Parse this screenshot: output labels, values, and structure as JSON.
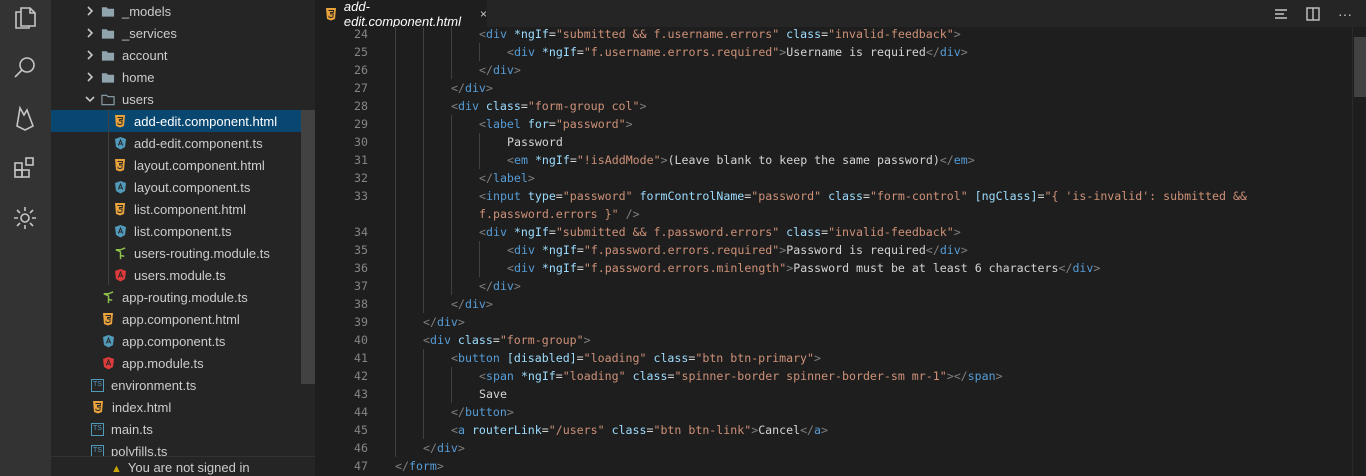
{
  "activity_bar": {
    "items": [
      {
        "icon": "files-icon"
      },
      {
        "icon": "search-icon"
      },
      {
        "icon": "firebase-icon"
      },
      {
        "icon": "extensions-icon"
      },
      {
        "icon": "gear-icon"
      }
    ]
  },
  "explorer": {
    "items": [
      {
        "label": "_models",
        "type": "folder",
        "depth": 1,
        "expanded": false
      },
      {
        "label": "_services",
        "type": "folder",
        "depth": 1,
        "expanded": false
      },
      {
        "label": "account",
        "type": "folder",
        "depth": 1,
        "expanded": false
      },
      {
        "label": "home",
        "type": "folder",
        "depth": 1,
        "expanded": false
      },
      {
        "label": "users",
        "type": "folder",
        "depth": 1,
        "expanded": true
      },
      {
        "label": "add-edit.component.html",
        "type": "html",
        "depth": 2,
        "selected": true
      },
      {
        "label": "add-edit.component.ts",
        "type": "angular-ts",
        "depth": 2
      },
      {
        "label": "layout.component.html",
        "type": "html",
        "depth": 2
      },
      {
        "label": "layout.component.ts",
        "type": "angular-ts",
        "depth": 2
      },
      {
        "label": "list.component.html",
        "type": "html",
        "depth": 2
      },
      {
        "label": "list.component.ts",
        "type": "angular-ts",
        "depth": 2
      },
      {
        "label": "users-routing.module.ts",
        "type": "routing",
        "depth": 2
      },
      {
        "label": "users.module.ts",
        "type": "angular-module",
        "depth": 2
      },
      {
        "label": "app-routing.module.ts",
        "type": "routing",
        "depth": 1
      },
      {
        "label": "app.component.html",
        "type": "html",
        "depth": 1
      },
      {
        "label": "app.component.ts",
        "type": "angular-ts",
        "depth": 1
      },
      {
        "label": "app.module.ts",
        "type": "angular-module",
        "depth": 1
      },
      {
        "label": "environment.ts",
        "type": "ts",
        "depth": 0
      },
      {
        "label": "index.html",
        "type": "html",
        "depth": 0
      },
      {
        "label": "main.ts",
        "type": "ts",
        "depth": 0
      },
      {
        "label": "polyfills.ts",
        "type": "ts",
        "depth": 0
      }
    ],
    "footer_text": "You are not signed in"
  },
  "tabs": [
    {
      "label": "add-edit.component.html",
      "close": "×",
      "active": true
    }
  ],
  "editor_actions": [
    {
      "icon": "open-changes-icon"
    },
    {
      "icon": "split-editor-icon"
    },
    {
      "icon": "more-actions-icon",
      "glyph": "···"
    }
  ],
  "code": {
    "lines": [
      {
        "n": "24",
        "indent": 3,
        "tokens": [
          [
            "p",
            "<"
          ],
          [
            "t",
            "div"
          ],
          [
            "x",
            " "
          ],
          [
            "a",
            "*ngIf"
          ],
          [
            "x",
            "="
          ],
          [
            "s",
            "\"submitted && f.username.errors\""
          ],
          [
            "x",
            " "
          ],
          [
            "a",
            "class"
          ],
          [
            "x",
            "="
          ],
          [
            "s",
            "\"invalid-feedback\""
          ],
          [
            "p",
            ">"
          ]
        ]
      },
      {
        "n": "25",
        "indent": 4,
        "tokens": [
          [
            "p",
            "<"
          ],
          [
            "t",
            "div"
          ],
          [
            "x",
            " "
          ],
          [
            "a",
            "*ngIf"
          ],
          [
            "x",
            "="
          ],
          [
            "s",
            "\"f.username.errors.required\""
          ],
          [
            "p",
            ">"
          ],
          [
            "x",
            "Username is required"
          ],
          [
            "p",
            "</"
          ],
          [
            "t",
            "div"
          ],
          [
            "p",
            ">"
          ]
        ]
      },
      {
        "n": "26",
        "indent": 3,
        "tokens": [
          [
            "p",
            "</"
          ],
          [
            "t",
            "div"
          ],
          [
            "p",
            ">"
          ]
        ]
      },
      {
        "n": "27",
        "indent": 2,
        "tokens": [
          [
            "p",
            "</"
          ],
          [
            "t",
            "div"
          ],
          [
            "p",
            ">"
          ]
        ]
      },
      {
        "n": "28",
        "indent": 2,
        "tokens": [
          [
            "p",
            "<"
          ],
          [
            "t",
            "div"
          ],
          [
            "x",
            " "
          ],
          [
            "a",
            "class"
          ],
          [
            "x",
            "="
          ],
          [
            "s",
            "\"form-group col\""
          ],
          [
            "p",
            ">"
          ]
        ]
      },
      {
        "n": "29",
        "indent": 3,
        "tokens": [
          [
            "p",
            "<"
          ],
          [
            "t",
            "label"
          ],
          [
            "x",
            " "
          ],
          [
            "a",
            "for"
          ],
          [
            "x",
            "="
          ],
          [
            "s",
            "\"password\""
          ],
          [
            "p",
            ">"
          ]
        ]
      },
      {
        "n": "30",
        "indent": 4,
        "tokens": [
          [
            "x",
            "Password"
          ]
        ]
      },
      {
        "n": "31",
        "indent": 4,
        "tokens": [
          [
            "p",
            "<"
          ],
          [
            "t",
            "em"
          ],
          [
            "x",
            " "
          ],
          [
            "a",
            "*ngIf"
          ],
          [
            "x",
            "="
          ],
          [
            "s",
            "\"!isAddMode\""
          ],
          [
            "p",
            ">"
          ],
          [
            "x",
            "(Leave blank to keep the same password)"
          ],
          [
            "p",
            "</"
          ],
          [
            "t",
            "em"
          ],
          [
            "p",
            ">"
          ]
        ]
      },
      {
        "n": "32",
        "indent": 3,
        "tokens": [
          [
            "p",
            "</"
          ],
          [
            "t",
            "label"
          ],
          [
            "p",
            ">"
          ]
        ]
      },
      {
        "n": "33",
        "indent": 3,
        "tokens": [
          [
            "p",
            "<"
          ],
          [
            "t",
            "input"
          ],
          [
            "x",
            " "
          ],
          [
            "a",
            "type"
          ],
          [
            "x",
            "="
          ],
          [
            "s",
            "\"password\""
          ],
          [
            "x",
            " "
          ],
          [
            "a",
            "formControlName"
          ],
          [
            "x",
            "="
          ],
          [
            "s",
            "\"password\""
          ],
          [
            "x",
            " "
          ],
          [
            "a",
            "class"
          ],
          [
            "x",
            "="
          ],
          [
            "s",
            "\"form-control\""
          ],
          [
            "x",
            " "
          ],
          [
            "a",
            "[ngClass]"
          ],
          [
            "x",
            "="
          ],
          [
            "s",
            "\"{ 'is-invalid': submitted &&"
          ]
        ]
      },
      {
        "n": "",
        "indent": 3,
        "tokens": [
          [
            "s",
            "f.password.errors }\""
          ],
          [
            "x",
            " "
          ],
          [
            "p",
            "/>"
          ]
        ]
      },
      {
        "n": "34",
        "indent": 3,
        "tokens": [
          [
            "p",
            "<"
          ],
          [
            "t",
            "div"
          ],
          [
            "x",
            " "
          ],
          [
            "a",
            "*ngIf"
          ],
          [
            "x",
            "="
          ],
          [
            "s",
            "\"submitted && f.password.errors\""
          ],
          [
            "x",
            " "
          ],
          [
            "a",
            "class"
          ],
          [
            "x",
            "="
          ],
          [
            "s",
            "\"invalid-feedback\""
          ],
          [
            "p",
            ">"
          ]
        ]
      },
      {
        "n": "35",
        "indent": 4,
        "tokens": [
          [
            "p",
            "<"
          ],
          [
            "t",
            "div"
          ],
          [
            "x",
            " "
          ],
          [
            "a",
            "*ngIf"
          ],
          [
            "x",
            "="
          ],
          [
            "s",
            "\"f.password.errors.required\""
          ],
          [
            "p",
            ">"
          ],
          [
            "x",
            "Password is required"
          ],
          [
            "p",
            "</"
          ],
          [
            "t",
            "div"
          ],
          [
            "p",
            ">"
          ]
        ]
      },
      {
        "n": "36",
        "indent": 4,
        "tokens": [
          [
            "p",
            "<"
          ],
          [
            "t",
            "div"
          ],
          [
            "x",
            " "
          ],
          [
            "a",
            "*ngIf"
          ],
          [
            "x",
            "="
          ],
          [
            "s",
            "\"f.password.errors.minlength\""
          ],
          [
            "p",
            ">"
          ],
          [
            "x",
            "Password must be at least 6 characters"
          ],
          [
            "p",
            "</"
          ],
          [
            "t",
            "div"
          ],
          [
            "p",
            ">"
          ]
        ]
      },
      {
        "n": "37",
        "indent": 3,
        "tokens": [
          [
            "p",
            "</"
          ],
          [
            "t",
            "div"
          ],
          [
            "p",
            ">"
          ]
        ]
      },
      {
        "n": "38",
        "indent": 2,
        "tokens": [
          [
            "p",
            "</"
          ],
          [
            "t",
            "div"
          ],
          [
            "p",
            ">"
          ]
        ]
      },
      {
        "n": "39",
        "indent": 1,
        "tokens": [
          [
            "p",
            "</"
          ],
          [
            "t",
            "div"
          ],
          [
            "p",
            ">"
          ]
        ]
      },
      {
        "n": "40",
        "indent": 1,
        "tokens": [
          [
            "p",
            "<"
          ],
          [
            "t",
            "div"
          ],
          [
            "x",
            " "
          ],
          [
            "a",
            "class"
          ],
          [
            "x",
            "="
          ],
          [
            "s",
            "\"form-group\""
          ],
          [
            "p",
            ">"
          ]
        ]
      },
      {
        "n": "41",
        "indent": 2,
        "tokens": [
          [
            "p",
            "<"
          ],
          [
            "t",
            "button"
          ],
          [
            "x",
            " "
          ],
          [
            "a",
            "[disabled]"
          ],
          [
            "x",
            "="
          ],
          [
            "s",
            "\"loading\""
          ],
          [
            "x",
            " "
          ],
          [
            "a",
            "class"
          ],
          [
            "x",
            "="
          ],
          [
            "s",
            "\"btn btn-primary\""
          ],
          [
            "p",
            ">"
          ]
        ]
      },
      {
        "n": "42",
        "indent": 3,
        "tokens": [
          [
            "p",
            "<"
          ],
          [
            "t",
            "span"
          ],
          [
            "x",
            " "
          ],
          [
            "a",
            "*ngIf"
          ],
          [
            "x",
            "="
          ],
          [
            "s",
            "\"loading\""
          ],
          [
            "x",
            " "
          ],
          [
            "a",
            "class"
          ],
          [
            "x",
            "="
          ],
          [
            "s",
            "\"spinner-border spinner-border-sm mr-1\""
          ],
          [
            "p",
            ">"
          ],
          [
            "p",
            "</"
          ],
          [
            "t",
            "span"
          ],
          [
            "p",
            ">"
          ]
        ]
      },
      {
        "n": "43",
        "indent": 3,
        "tokens": [
          [
            "x",
            "Save"
          ]
        ]
      },
      {
        "n": "44",
        "indent": 2,
        "tokens": [
          [
            "p",
            "</"
          ],
          [
            "t",
            "button"
          ],
          [
            "p",
            ">"
          ]
        ]
      },
      {
        "n": "45",
        "indent": 2,
        "tokens": [
          [
            "p",
            "<"
          ],
          [
            "t",
            "a"
          ],
          [
            "x",
            " "
          ],
          [
            "a",
            "routerLink"
          ],
          [
            "x",
            "="
          ],
          [
            "s",
            "\"/users\""
          ],
          [
            "x",
            " "
          ],
          [
            "a",
            "class"
          ],
          [
            "x",
            "="
          ],
          [
            "s",
            "\"btn btn-link\""
          ],
          [
            "p",
            ">"
          ],
          [
            "x",
            "Cancel"
          ],
          [
            "p",
            "</"
          ],
          [
            "t",
            "a"
          ],
          [
            "p",
            ">"
          ]
        ]
      },
      {
        "n": "46",
        "indent": 1,
        "tokens": [
          [
            "p",
            "</"
          ],
          [
            "t",
            "div"
          ],
          [
            "p",
            ">"
          ]
        ]
      },
      {
        "n": "47",
        "indent": 0,
        "tokens": [
          [
            "p",
            "</"
          ],
          [
            "t",
            "form"
          ],
          [
            "p",
            ">"
          ]
        ]
      }
    ]
  },
  "colors": {
    "tag": "#569cd6",
    "attribute": "#9cdcfe",
    "string": "#ce9178",
    "punctuation": "#808080",
    "text": "#d4d4d4",
    "selection": "#094771"
  }
}
